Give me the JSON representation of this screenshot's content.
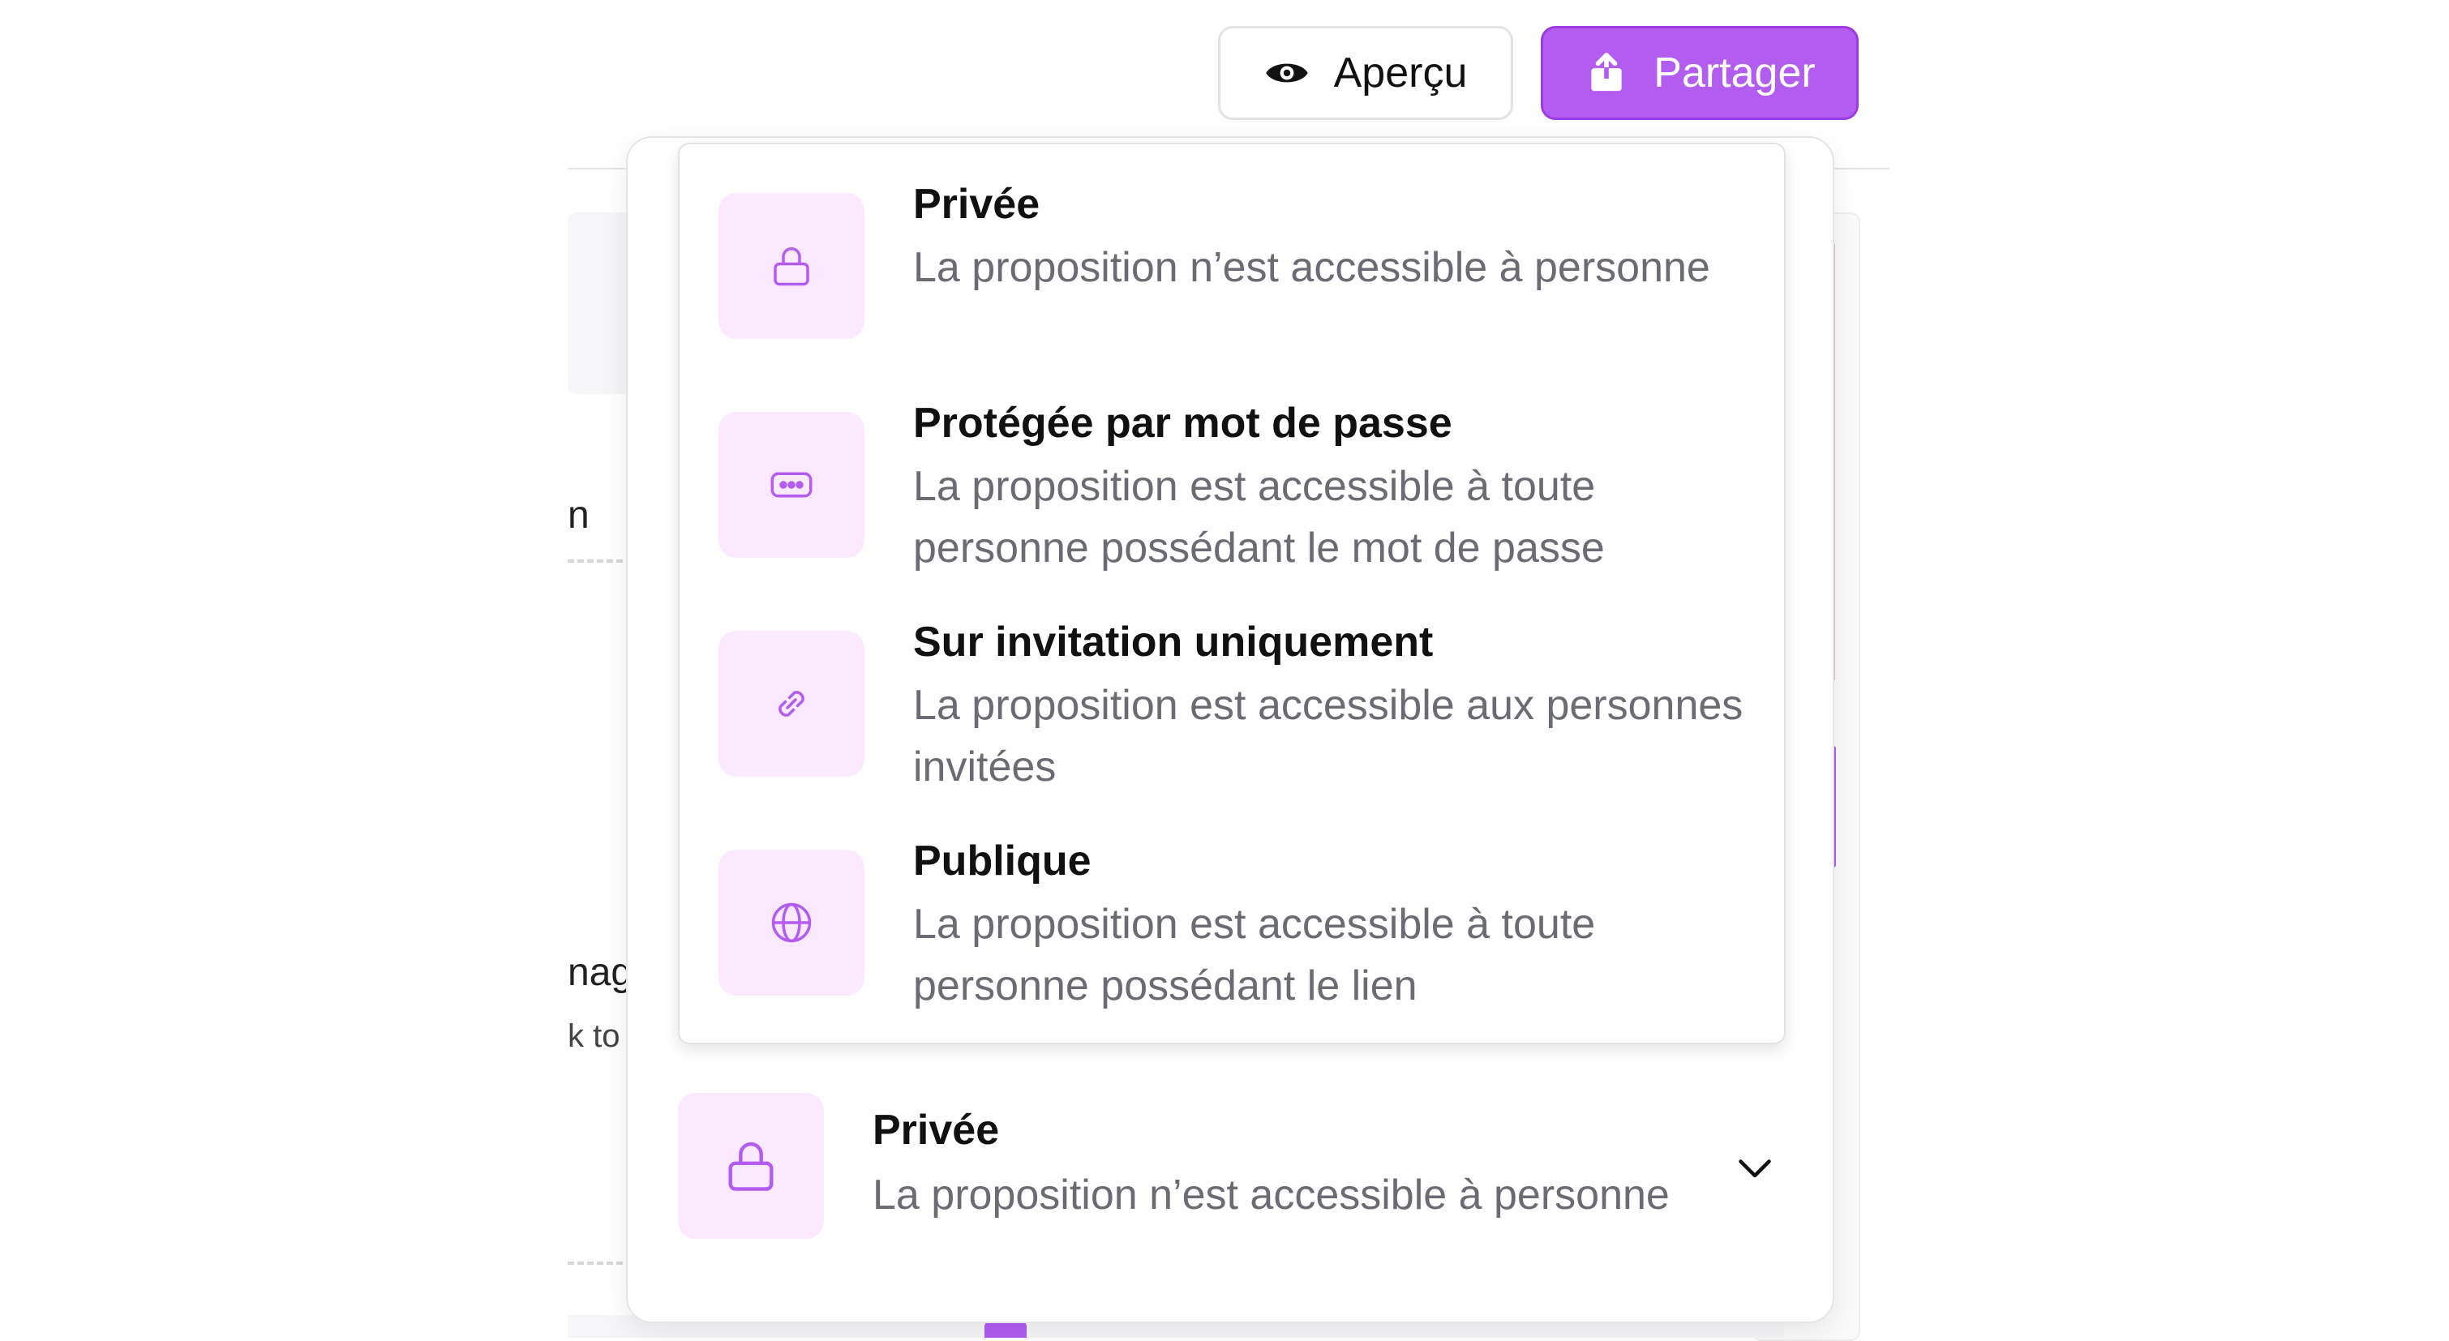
{
  "header": {
    "preview_label": "Aperçu",
    "share_label": "Partager"
  },
  "background": {
    "fragment_1": "n",
    "fragment_2": "nag",
    "fragment_3": "k to"
  },
  "visibility_menu": {
    "options": [
      {
        "icon": "lock-icon",
        "title": "Privée",
        "description": "La proposition n’est accessible à personne"
      },
      {
        "icon": "password-icon",
        "title": "Protégée par mot de passe",
        "description": "La proposition est accessible à toute personne possédant le mot de passe"
      },
      {
        "icon": "link-icon",
        "title": "Sur invitation uniquement",
        "description": "La proposition est accessible aux personnes invitées"
      },
      {
        "icon": "globe-icon",
        "title": "Publique",
        "description": "La proposition est accessible à toute personne possédant le lien"
      }
    ],
    "selected": {
      "icon": "lock-icon",
      "title": "Privée",
      "description": "La proposition n’est accessible à personne"
    }
  },
  "colors": {
    "accent": "#b25cf0",
    "icon_bg": "#fbeaff",
    "muted_text": "#6b6b73"
  }
}
